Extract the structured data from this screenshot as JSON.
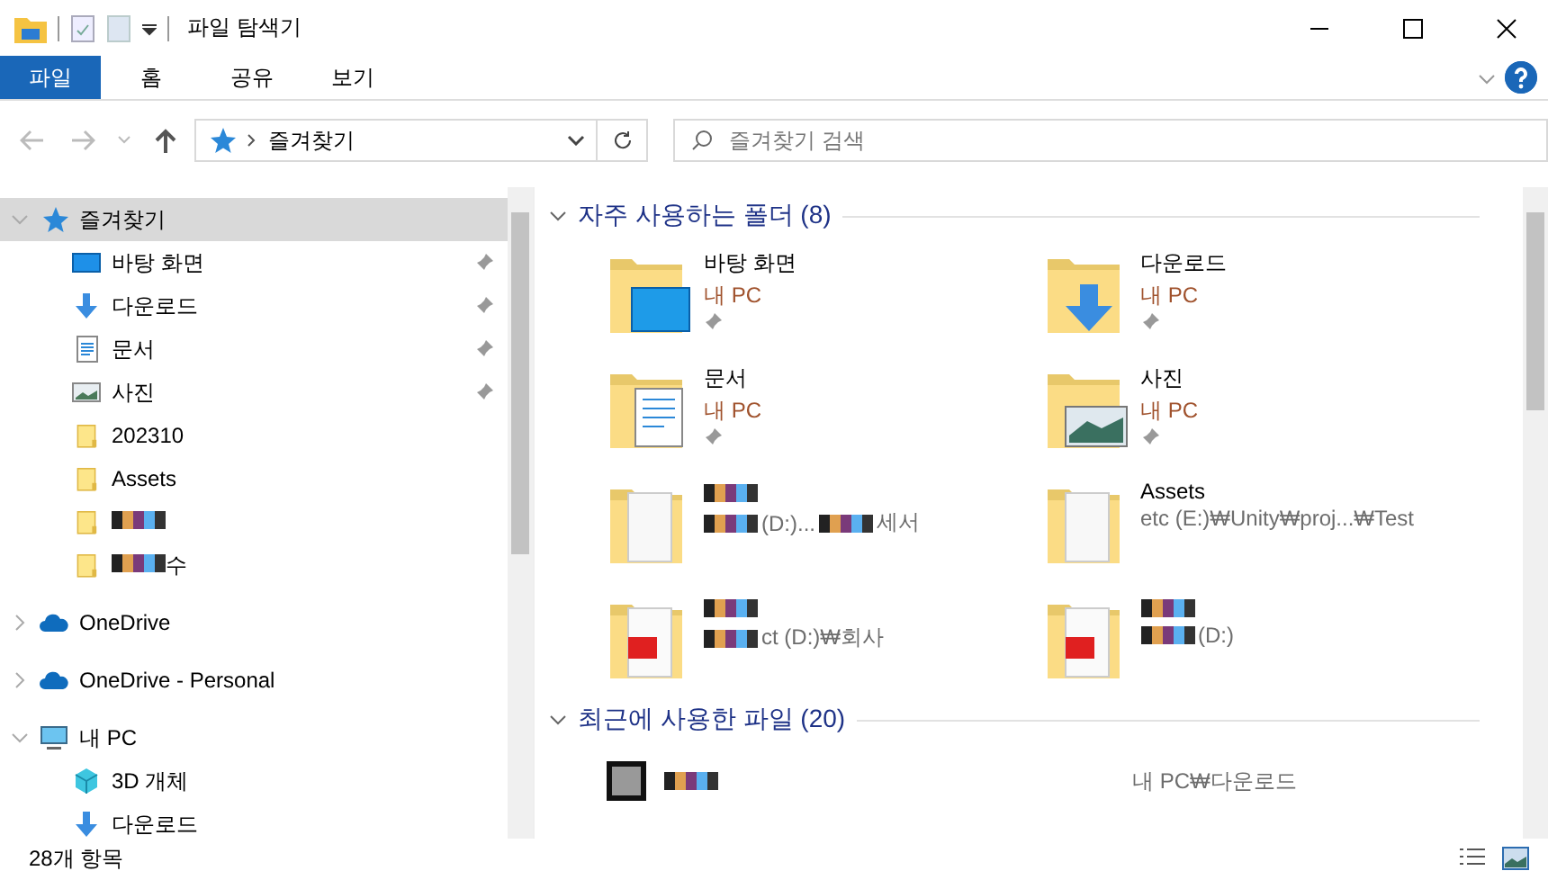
{
  "window": {
    "title": "파일 탐색기"
  },
  "ribbon_tabs": [
    {
      "label": "파일",
      "selected": true
    },
    {
      "label": "홈",
      "selected": false
    },
    {
      "label": "공유",
      "selected": false
    },
    {
      "label": "보기",
      "selected": false
    }
  ],
  "address": {
    "location": "즐겨찾기"
  },
  "search": {
    "placeholder": "즐겨찾기 검색"
  },
  "nav": [
    {
      "label": "즐겨찾기",
      "kind": "star",
      "expanded": true,
      "selected": true,
      "children": [
        {
          "label": "바탕 화면",
          "kind": "desktop",
          "pinned": true,
          "selected": false
        },
        {
          "label": "다운로드",
          "kind": "download",
          "pinned": true,
          "selected": false
        },
        {
          "label": "문서",
          "kind": "document",
          "pinned": true,
          "selected": false
        },
        {
          "label": "사진",
          "kind": "picture",
          "pinned": true,
          "selected": false
        },
        {
          "label": "202310",
          "kind": "folder",
          "pinned": false,
          "selected": false
        },
        {
          "label": "Assets",
          "kind": "folder",
          "pinned": false,
          "selected": false
        },
        {
          "redacted": true,
          "kind": "folder",
          "pinned": false,
          "selected": false
        },
        {
          "redacted": true,
          "tail": "수",
          "kind": "folder",
          "pinned": false,
          "selected": false
        }
      ]
    },
    {
      "label": "OneDrive",
      "kind": "cloud",
      "expanded": false,
      "selected": false
    },
    {
      "label": "OneDrive - Personal",
      "kind": "cloud",
      "expanded": false,
      "selected": false
    },
    {
      "label": "내 PC",
      "kind": "pc",
      "expanded": true,
      "selected": false,
      "children": [
        {
          "label": "3D 개체",
          "kind": "cube",
          "selected": false
        },
        {
          "label": "다운로드",
          "kind": "download",
          "selected": false
        }
      ]
    }
  ],
  "frequent_folders": {
    "title": "자주 사용하는 폴더 (8)",
    "items": [
      {
        "name": "바탕 화면",
        "location": "내 PC",
        "pinned": true,
        "kind": "desktop"
      },
      {
        "name": "다운로드",
        "location": "내 PC",
        "pinned": true,
        "kind": "download"
      },
      {
        "name": "문서",
        "location": "내 PC",
        "pinned": true,
        "kind": "document"
      },
      {
        "name": "사진",
        "location": "내 PC",
        "pinned": true,
        "kind": "picture"
      },
      {
        "redacted": true,
        "location": "(D:)...",
        "location_tail": "세서",
        "pinned": false,
        "kind": "papers"
      },
      {
        "name": "Assets",
        "location": "etc (E:)₩Unity₩proj...₩Test",
        "pinned": false,
        "kind": "papers"
      },
      {
        "redacted": true,
        "location": "ct (D:)₩회사",
        "pinned": false,
        "kind": "pdf"
      },
      {
        "redacted": true,
        "location": "(D:)",
        "pinned": false,
        "kind": "pdf"
      }
    ]
  },
  "recent_files": {
    "title": "최근에 사용한 파일 (20)",
    "items": [
      {
        "redacted": true,
        "location": "내 PC₩다운로드"
      }
    ]
  },
  "status_bar": {
    "item_count": "28개 항목"
  }
}
